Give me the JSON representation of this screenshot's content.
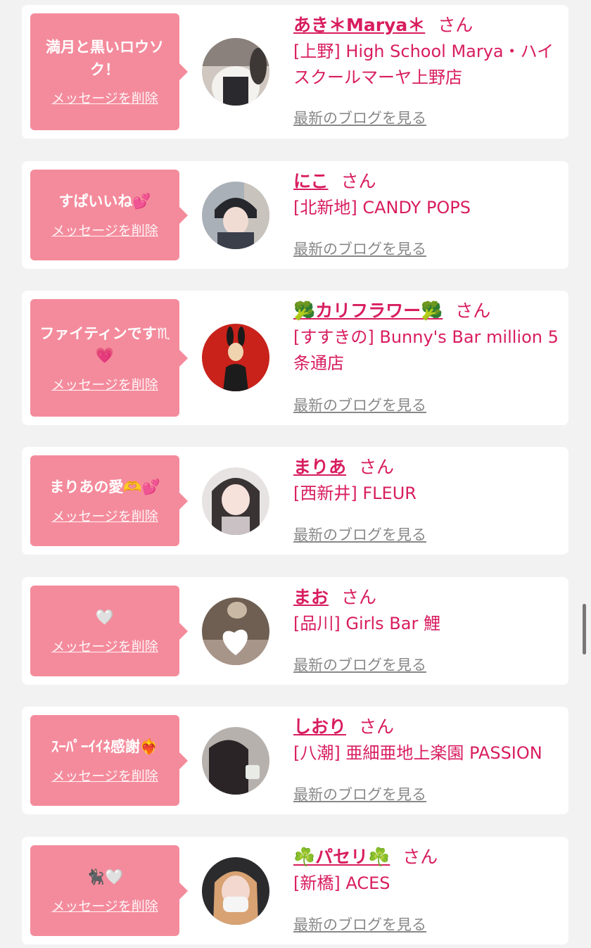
{
  "items": [
    {
      "message": "満月と黒いロウソク！",
      "delete_label": "メッセージを削除",
      "name": "あき＊Marya＊",
      "honorific": "さん",
      "shop": "[上野] High School Marya・ハイスクールマーヤ上野店",
      "blog_label": "最新のブログを見る"
    },
    {
      "message": "すぱいいね💕",
      "delete_label": "メッセージを削除",
      "name": "にこ",
      "honorific": "さん",
      "shop": "[北新地] CANDY POPS",
      "blog_label": "最新のブログを見る"
    },
    {
      "message": "ファイティンです♏💗",
      "delete_label": "メッセージを削除",
      "name": "🥦カリフラワー🥦",
      "honorific": "さん",
      "shop": "[すすきの] Bunny's Bar million 5条通店",
      "blog_label": "最新のブログを見る"
    },
    {
      "message": "まりあの愛🫶💕",
      "delete_label": "メッセージを削除",
      "name": "まりあ",
      "honorific": "さん",
      "shop": "[西新井] FLEUR",
      "blog_label": "最新のブログを見る"
    },
    {
      "message": "🤍",
      "delete_label": "メッセージを削除",
      "name": "まお",
      "honorific": "さん",
      "shop": "[品川] Girls Bar 鯉",
      "blog_label": "最新のブログを見る"
    },
    {
      "message": "ｽｰﾊﾟｰｲｲﾈ感謝❤️‍🔥",
      "delete_label": "メッセージを削除",
      "name": "しおり",
      "honorific": "さん",
      "shop": "[八潮] 亜細亜地上楽園 PASSION",
      "blog_label": "最新のブログを見る"
    },
    {
      "message": "🐈‍⬛🤍",
      "delete_label": "メッセージを削除",
      "name": "☘️パセリ☘️",
      "honorific": "さん",
      "shop": "[新橋] ACES",
      "blog_label": "最新のブログを見る"
    }
  ],
  "colors": {
    "accent": "#d81d5f",
    "bubble": "#f48b9c",
    "page_bg": "#f2f2f2"
  }
}
